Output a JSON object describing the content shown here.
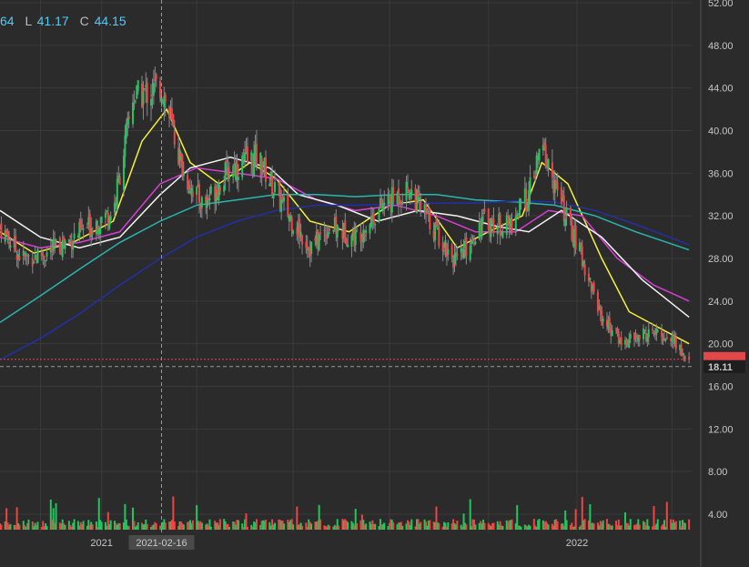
{
  "ohlc": {
    "partial_label": "64",
    "low_key": "L",
    "low_value": "41.17",
    "close_key": "C",
    "close_value": "44.15"
  },
  "crosshair": {
    "date_label": "2021-02-16"
  },
  "colors": {
    "background": "#2b2b2b",
    "grid": "#3a3a3a",
    "up_candle": "#22c55e",
    "down_candle": "#ef4444",
    "price_tag_bg": "#e34848",
    "ma_yellow": "#f4f13a",
    "ma_magenta": "#d63ed6",
    "ma_white": "#f2f2f2",
    "ma_teal": "#29b6b0",
    "ma_navy": "#2230a8"
  },
  "chart_data": {
    "type": "candlestick",
    "ylim": [
      0,
      52
    ],
    "y_ticks": [
      "4.00",
      "8.00",
      "12.00",
      "16.00",
      "20.00",
      "24.00",
      "28.00",
      "32.00",
      "36.00",
      "40.00",
      "44.00",
      "48.00",
      "52.00"
    ],
    "x_labels": [
      {
        "label": "2021",
        "date": "2021-01-01"
      },
      {
        "label": "2022",
        "date": "2022-01-01"
      }
    ],
    "last_price": "18.11",
    "last_price_value": 18.11,
    "price_anchors": [
      {
        "date": "2020-10-15",
        "close": 31.0
      },
      {
        "date": "2020-11-01",
        "close": 28.0
      },
      {
        "date": "2020-11-20",
        "close": 28.5
      },
      {
        "date": "2020-12-10",
        "close": 30.0
      },
      {
        "date": "2021-01-10",
        "close": 32.5
      },
      {
        "date": "2021-01-25",
        "close": 43.0
      },
      {
        "date": "2021-02-16",
        "close": 44.15
      },
      {
        "date": "2021-03-05",
        "close": 36.0
      },
      {
        "date": "2021-03-20",
        "close": 33.0
      },
      {
        "date": "2021-04-10",
        "close": 36.5
      },
      {
        "date": "2021-05-01",
        "close": 37.5
      },
      {
        "date": "2021-05-20",
        "close": 33.0
      },
      {
        "date": "2021-06-10",
        "close": 29.0
      },
      {
        "date": "2021-06-25",
        "close": 31.0
      },
      {
        "date": "2021-07-15",
        "close": 30.0
      },
      {
        "date": "2021-08-05",
        "close": 33.0
      },
      {
        "date": "2021-08-25",
        "close": 34.5
      },
      {
        "date": "2021-09-15",
        "close": 30.5
      },
      {
        "date": "2021-10-01",
        "close": 27.5
      },
      {
        "date": "2021-10-20",
        "close": 31.5
      },
      {
        "date": "2021-11-10",
        "close": 31.0
      },
      {
        "date": "2021-11-25",
        "close": 34.0
      },
      {
        "date": "2021-12-05",
        "close": 38.5
      },
      {
        "date": "2021-12-20",
        "close": 33.0
      },
      {
        "date": "2022-01-05",
        "close": 28.0
      },
      {
        "date": "2022-01-20",
        "close": 22.5
      },
      {
        "date": "2022-02-05",
        "close": 20.0
      },
      {
        "date": "2022-02-25",
        "close": 21.0
      },
      {
        "date": "2022-03-15",
        "close": 20.5
      },
      {
        "date": "2022-03-28",
        "close": 18.11
      }
    ],
    "moving_averages": [
      {
        "color": "#f4f13a",
        "points": [
          {
            "date": "2020-10-15",
            "value": 30.5
          },
          {
            "date": "2020-11-10",
            "value": 28.5
          },
          {
            "date": "2020-12-10",
            "value": 29.5
          },
          {
            "date": "2021-01-10",
            "value": 31.5
          },
          {
            "date": "2021-02-01",
            "value": 39.0
          },
          {
            "date": "2021-02-20",
            "value": 42.0
          },
          {
            "date": "2021-03-10",
            "value": 37.0
          },
          {
            "date": "2021-04-01",
            "value": 35.0
          },
          {
            "date": "2021-04-25",
            "value": 37.0
          },
          {
            "date": "2021-05-15",
            "value": 35.5
          },
          {
            "date": "2021-06-10",
            "value": 31.5
          },
          {
            "date": "2021-07-10",
            "value": 30.5
          },
          {
            "date": "2021-08-10",
            "value": 33.0
          },
          {
            "date": "2021-09-05",
            "value": 33.5
          },
          {
            "date": "2021-10-01",
            "value": 29.0
          },
          {
            "date": "2021-10-25",
            "value": 30.5
          },
          {
            "date": "2021-11-20",
            "value": 32.0
          },
          {
            "date": "2021-12-05",
            "value": 37.0
          },
          {
            "date": "2021-12-25",
            "value": 35.0
          },
          {
            "date": "2022-01-20",
            "value": 28.0
          },
          {
            "date": "2022-02-10",
            "value": 23.0
          },
          {
            "date": "2022-03-05",
            "value": 21.5
          },
          {
            "date": "2022-03-28",
            "value": 20.0
          }
        ]
      },
      {
        "color": "#d63ed6",
        "points": [
          {
            "date": "2020-10-15",
            "value": 30.0
          },
          {
            "date": "2020-11-15",
            "value": 29.0
          },
          {
            "date": "2020-12-15",
            "value": 29.5
          },
          {
            "date": "2021-01-15",
            "value": 30.5
          },
          {
            "date": "2021-02-15",
            "value": 35.0
          },
          {
            "date": "2021-03-15",
            "value": 36.5
          },
          {
            "date": "2021-04-15",
            "value": 36.0
          },
          {
            "date": "2021-05-15",
            "value": 35.5
          },
          {
            "date": "2021-06-15",
            "value": 33.5
          },
          {
            "date": "2021-07-15",
            "value": 32.5
          },
          {
            "date": "2021-08-15",
            "value": 33.0
          },
          {
            "date": "2021-09-15",
            "value": 32.0
          },
          {
            "date": "2021-10-15",
            "value": 30.5
          },
          {
            "date": "2021-11-15",
            "value": 30.5
          },
          {
            "date": "2021-12-10",
            "value": 32.5
          },
          {
            "date": "2022-01-05",
            "value": 32.0
          },
          {
            "date": "2022-02-01",
            "value": 28.0
          },
          {
            "date": "2022-03-01",
            "value": 25.5
          },
          {
            "date": "2022-03-28",
            "value": 24.0
          }
        ]
      },
      {
        "color": "#f2f2f2",
        "points": [
          {
            "date": "2020-10-15",
            "value": 32.5
          },
          {
            "date": "2020-11-15",
            "value": 30.0
          },
          {
            "date": "2020-12-15",
            "value": 29.0
          },
          {
            "date": "2021-01-15",
            "value": 30.0
          },
          {
            "date": "2021-02-15",
            "value": 34.0
          },
          {
            "date": "2021-03-10",
            "value": 36.5
          },
          {
            "date": "2021-04-10",
            "value": 37.5
          },
          {
            "date": "2021-05-10",
            "value": 36.5
          },
          {
            "date": "2021-06-01",
            "value": 34.0
          },
          {
            "date": "2021-07-01",
            "value": 33.0
          },
          {
            "date": "2021-08-01",
            "value": 31.5
          },
          {
            "date": "2021-09-01",
            "value": 32.5
          },
          {
            "date": "2021-10-01",
            "value": 32.0
          },
          {
            "date": "2021-11-01",
            "value": 31.0
          },
          {
            "date": "2021-11-25",
            "value": 30.5
          },
          {
            "date": "2021-12-20",
            "value": 32.5
          },
          {
            "date": "2022-01-20",
            "value": 30.0
          },
          {
            "date": "2022-02-20",
            "value": 26.0
          },
          {
            "date": "2022-03-28",
            "value": 22.5
          }
        ]
      },
      {
        "color": "#29b6b0",
        "points": [
          {
            "date": "2020-10-15",
            "value": 22.0
          },
          {
            "date": "2020-11-15",
            "value": 24.5
          },
          {
            "date": "2020-12-15",
            "value": 27.0
          },
          {
            "date": "2021-01-15",
            "value": 29.5
          },
          {
            "date": "2021-02-15",
            "value": 31.5
          },
          {
            "date": "2021-03-15",
            "value": 33.0
          },
          {
            "date": "2021-04-15",
            "value": 33.5
          },
          {
            "date": "2021-05-15",
            "value": 34.0
          },
          {
            "date": "2021-06-15",
            "value": 34.0
          },
          {
            "date": "2021-07-15",
            "value": 33.8
          },
          {
            "date": "2021-08-15",
            "value": 34.0
          },
          {
            "date": "2021-09-15",
            "value": 34.0
          },
          {
            "date": "2021-10-15",
            "value": 33.5
          },
          {
            "date": "2021-11-15",
            "value": 33.3
          },
          {
            "date": "2021-12-15",
            "value": 33.0
          },
          {
            "date": "2022-01-15",
            "value": 32.0
          },
          {
            "date": "2022-02-15",
            "value": 30.5
          },
          {
            "date": "2022-03-28",
            "value": 28.8
          }
        ]
      },
      {
        "color": "#2230a8",
        "points": [
          {
            "date": "2020-10-15",
            "value": 18.5
          },
          {
            "date": "2020-11-15",
            "value": 20.5
          },
          {
            "date": "2020-12-15",
            "value": 22.8
          },
          {
            "date": "2021-01-15",
            "value": 25.5
          },
          {
            "date": "2021-02-15",
            "value": 28.0
          },
          {
            "date": "2021-03-15",
            "value": 30.0
          },
          {
            "date": "2021-04-15",
            "value": 31.5
          },
          {
            "date": "2021-05-15",
            "value": 32.5
          },
          {
            "date": "2021-06-15",
            "value": 33.0
          },
          {
            "date": "2021-07-15",
            "value": 33.0
          },
          {
            "date": "2021-08-15",
            "value": 33.1
          },
          {
            "date": "2021-09-15",
            "value": 33.2
          },
          {
            "date": "2021-10-15",
            "value": 33.2
          },
          {
            "date": "2021-11-15",
            "value": 33.4
          },
          {
            "date": "2021-12-15",
            "value": 33.3
          },
          {
            "date": "2022-01-15",
            "value": 32.5
          },
          {
            "date": "2022-02-15",
            "value": 31.2
          },
          {
            "date": "2022-03-28",
            "value": 29.3
          }
        ]
      }
    ]
  }
}
